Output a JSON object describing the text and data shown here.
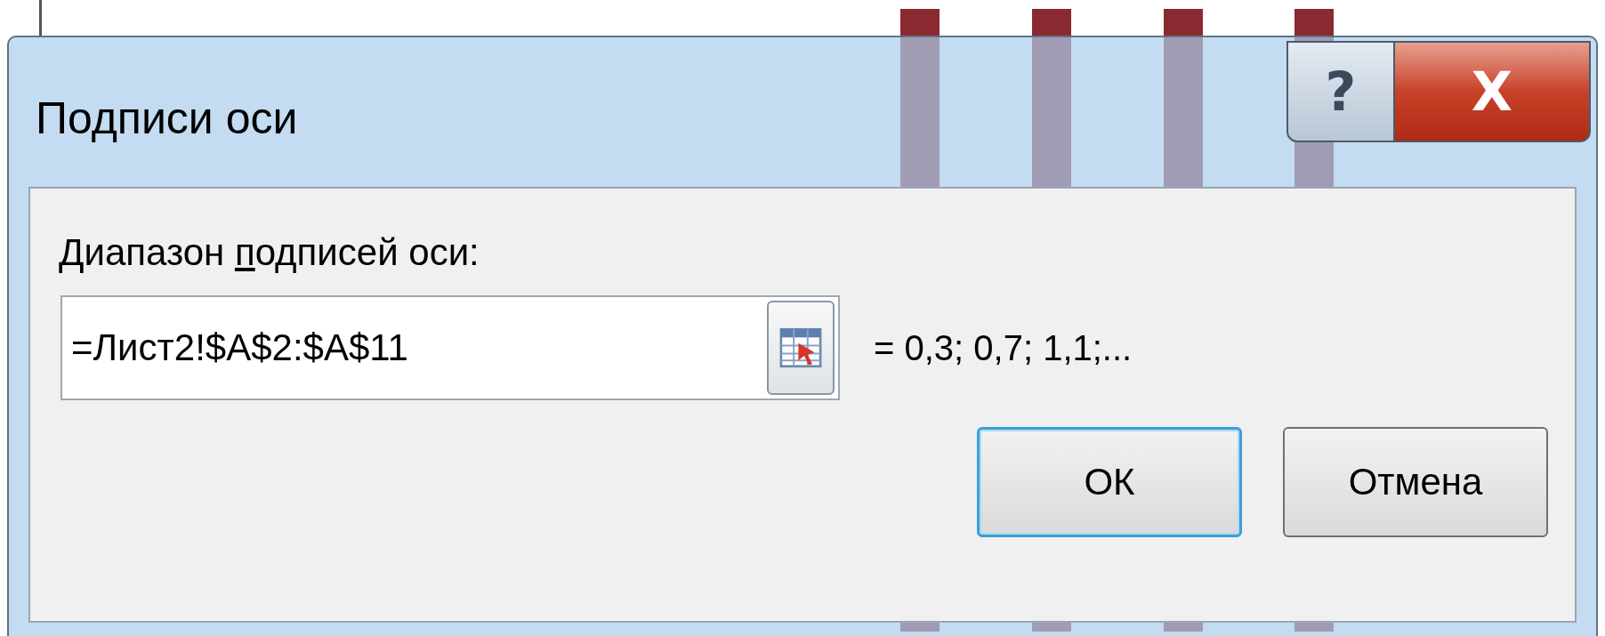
{
  "window": {
    "title": "Подписи оси",
    "help_button": "?",
    "close_button": "X"
  },
  "range": {
    "label": {
      "before": "Диапазон ",
      "key": "п",
      "after": "одписей оси:"
    },
    "value": "=Лист2!$A$2:$A$11",
    "preview": "= 0,3; 0,7; 1,1;..."
  },
  "buttons": [
    {
      "label": "ОК",
      "selected": true
    },
    {
      "label": "Отмена",
      "selected": false
    }
  ]
}
